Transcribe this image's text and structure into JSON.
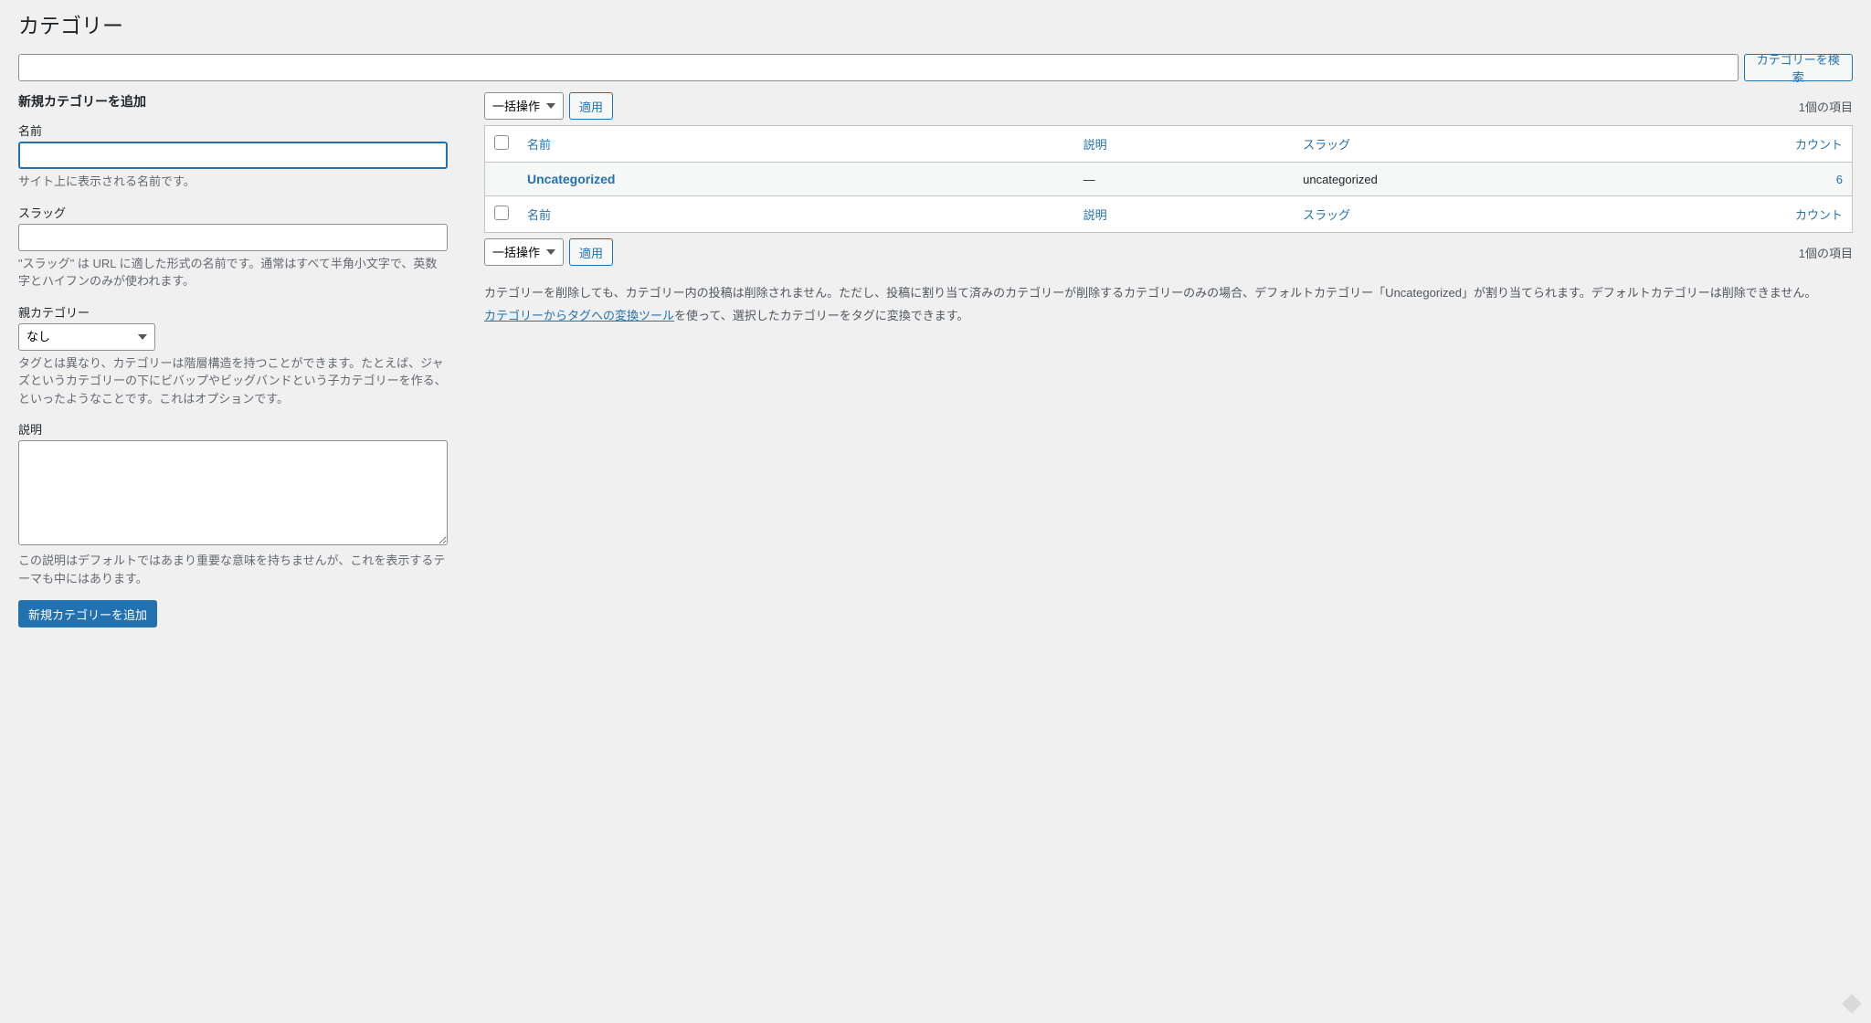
{
  "page": {
    "title": "カテゴリー"
  },
  "search": {
    "value": "",
    "button": "カテゴリーを検索"
  },
  "form": {
    "heading": "新規カテゴリーを追加",
    "name": {
      "label": "名前",
      "value": "",
      "hint": "サイト上に表示される名前です。"
    },
    "slug": {
      "label": "スラッグ",
      "value": "",
      "hint": "\"スラッグ\" は URL に適した形式の名前です。通常はすべて半角小文字で、英数字とハイフンのみが使われます。"
    },
    "parent": {
      "label": "親カテゴリー",
      "selected": "なし",
      "hint": "タグとは異なり、カテゴリーは階層構造を持つことができます。たとえば、ジャズというカテゴリーの下にビバップやビッグバンドという子カテゴリーを作る、といったようなことです。これはオプションです。"
    },
    "description": {
      "label": "説明",
      "value": "",
      "hint": "この説明はデフォルトではあまり重要な意味を持ちませんが、これを表示するテーマも中にはあります。"
    },
    "submit": "新規カテゴリーを追加"
  },
  "table": {
    "bulk_action": "一括操作",
    "apply": "適用",
    "count_text": "1個の項目",
    "cols": {
      "name": "名前",
      "desc": "説明",
      "slug": "スラッグ",
      "count": "カウント"
    },
    "rows": [
      {
        "name": "Uncategorized",
        "desc": "—",
        "slug": "uncategorized",
        "count": "6"
      }
    ]
  },
  "notes": {
    "delete_note": "カテゴリーを削除しても、カテゴリー内の投稿は削除されません。ただし、投稿に割り当て済みのカテゴリーが削除するカテゴリーのみの場合、デフォルトカテゴリー「Uncategorized」が割り当てられます。デフォルトカテゴリーは削除できません。",
    "convert_link": "カテゴリーからタグへの変換ツール",
    "convert_tail": "を使って、選択したカテゴリーをタグに変換できます。"
  }
}
